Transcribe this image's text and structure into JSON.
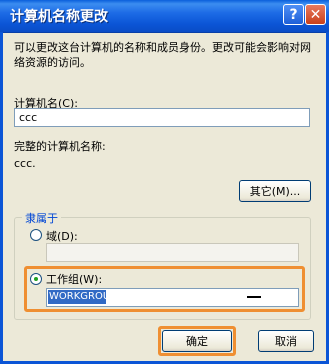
{
  "window": {
    "title": "计算机名称更改",
    "help_glyph": "?",
    "close_glyph": "✕"
  },
  "description": "可以更改这台计算机的名称和成员身份。更改可能会影响对网络资源的访问。",
  "computer_name": {
    "label": "计算机名(C):",
    "value": "ccc"
  },
  "full_name": {
    "label": "完整的计算机名称:",
    "value": "ccc."
  },
  "more_button": "其它(M)...",
  "member_of": {
    "label": "隶属于",
    "domain_label": "域(D):",
    "domain_value": "",
    "domain_selected": false,
    "workgroup_label": "工作组(W):",
    "workgroup_value": "WORKGROUP",
    "workgroup_selected": true
  },
  "buttons": {
    "ok": "确定",
    "cancel": "取消"
  },
  "colors": {
    "titlebar": "#0b55d6",
    "highlight": "#ef8f32",
    "selection": "#316ac5"
  }
}
